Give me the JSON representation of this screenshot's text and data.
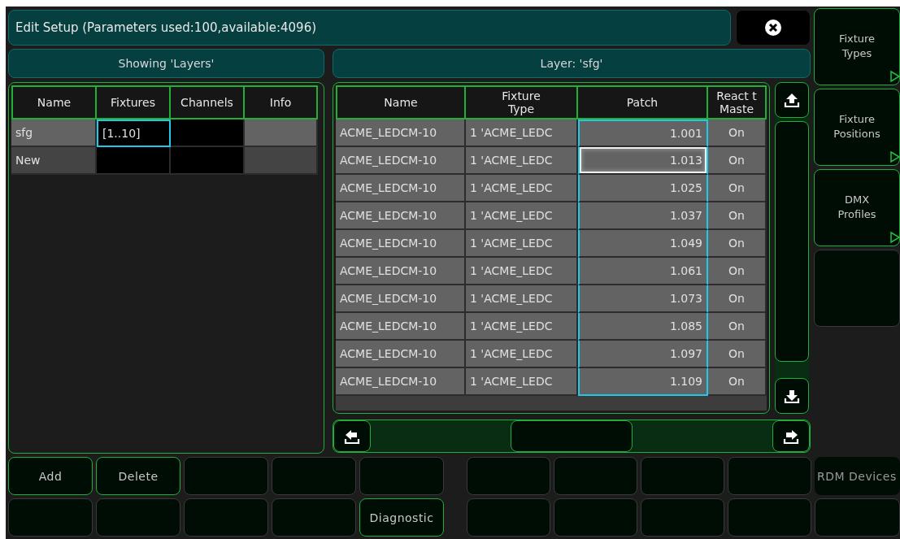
{
  "window": {
    "title": "Edit Setup (Parameters used:100,available:4096)"
  },
  "sidebar": {
    "items": [
      {
        "label": "Fixture\nTypes",
        "enabled": true,
        "submenu": true
      },
      {
        "label": "Fixture\nPositions",
        "enabled": true,
        "submenu": true
      },
      {
        "label": "DMX\nProfiles",
        "enabled": true,
        "submenu": true
      },
      {
        "enabled": false,
        "submenu": false
      }
    ]
  },
  "layers_panel": {
    "header": "Showing 'Layers'",
    "columns": [
      {
        "label": "Name",
        "kind": "text",
        "selected": false
      },
      {
        "label": "Fixtures",
        "kind": "field",
        "selected": true
      },
      {
        "label": "Channels",
        "kind": "field",
        "selected": false
      },
      {
        "label": "Info",
        "kind": "text",
        "selected": false
      }
    ],
    "rows": [
      {
        "selected": true,
        "cursor": false,
        "cells": [
          "sfg",
          "[1..10]",
          null,
          null
        ]
      },
      {
        "selected": false,
        "cursor": false,
        "cells": [
          "New",
          null,
          null,
          null
        ]
      }
    ]
  },
  "fixtures_panel": {
    "header": "Layer: 'sfg'",
    "columns": [
      {
        "label": "Name",
        "kind": "text",
        "selected": false
      },
      {
        "label": "Fixture\nType",
        "kind": "text",
        "selected": false
      },
      {
        "label": "Patch",
        "kind": "number",
        "selected": true
      },
      {
        "label": "React t\nMaste",
        "kind": "text",
        "selected": false
      }
    ],
    "rows": [
      {
        "selected": true,
        "cursor": false,
        "cells": [
          "ACME_LEDCM-10",
          "1 'ACME_LEDC",
          "1.001",
          "On"
        ]
      },
      {
        "selected": true,
        "cursor": true,
        "cells": [
          "ACME_LEDCM-10",
          "1 'ACME_LEDC",
          "1.013",
          "On"
        ]
      },
      {
        "selected": true,
        "cursor": false,
        "cells": [
          "ACME_LEDCM-10",
          "1 'ACME_LEDC",
          "1.025",
          "On"
        ]
      },
      {
        "selected": true,
        "cursor": false,
        "cells": [
          "ACME_LEDCM-10",
          "1 'ACME_LEDC",
          "1.037",
          "On"
        ]
      },
      {
        "selected": true,
        "cursor": false,
        "cells": [
          "ACME_LEDCM-10",
          "1 'ACME_LEDC",
          "1.049",
          "On"
        ]
      },
      {
        "selected": true,
        "cursor": false,
        "cells": [
          "ACME_LEDCM-10",
          "1 'ACME_LEDC",
          "1.061",
          "On"
        ]
      },
      {
        "selected": true,
        "cursor": false,
        "cells": [
          "ACME_LEDCM-10",
          "1 'ACME_LEDC",
          "1.073",
          "On"
        ]
      },
      {
        "selected": true,
        "cursor": false,
        "cells": [
          "ACME_LEDCM-10",
          "1 'ACME_LEDC",
          "1.085",
          "On"
        ]
      },
      {
        "selected": true,
        "cursor": false,
        "cells": [
          "ACME_LEDCM-10",
          "1 'ACME_LEDC",
          "1.097",
          "On"
        ]
      },
      {
        "selected": true,
        "cursor": false,
        "cells": [
          "ACME_LEDCM-10",
          "1 'ACME_LEDC",
          "1.109",
          "On"
        ]
      }
    ]
  },
  "button_rows": [
    [
      {
        "label": "Add",
        "enabled": true
      },
      {
        "label": "Delete",
        "enabled": true
      },
      {
        "enabled": false
      },
      {
        "enabled": false
      },
      {
        "enabled": false
      },
      {
        "enabled": false
      },
      {
        "enabled": false
      },
      {
        "enabled": false
      },
      {
        "enabled": false
      },
      {
        "label": "RDM Devices",
        "enabled": false
      }
    ],
    [
      {
        "enabled": false
      },
      {
        "enabled": false
      },
      {
        "enabled": false
      },
      {
        "enabled": false
      },
      {
        "label": "Diagnostic",
        "enabled": true
      },
      {
        "enabled": false
      },
      {
        "enabled": false
      },
      {
        "enabled": false
      },
      {
        "enabled": false
      },
      {
        "enabled": false
      }
    ]
  ]
}
